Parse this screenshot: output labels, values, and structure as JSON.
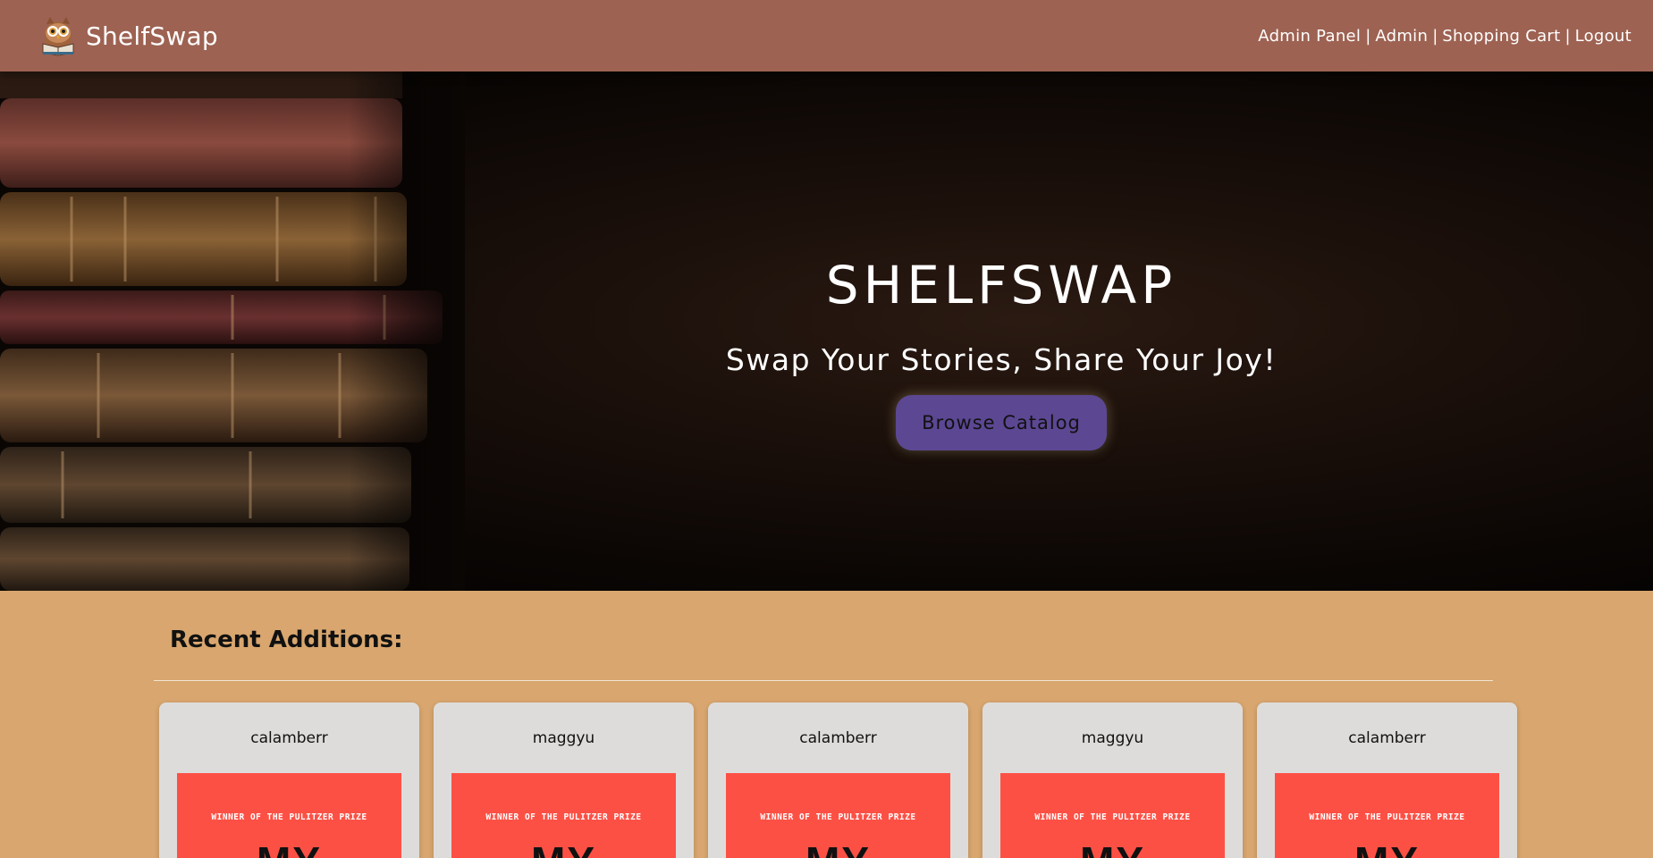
{
  "header": {
    "brand": "ShelfSwap",
    "nav": [
      {
        "label": "Admin Panel"
      },
      {
        "label": "Admin"
      },
      {
        "label": "Shopping Cart"
      },
      {
        "label": "Logout"
      }
    ],
    "separator": "|",
    "logo_icon": "owl-reading-book-icon"
  },
  "hero": {
    "title": "SHELFSWAP",
    "subtitle": "Swap Your Stories, Share Your Joy!",
    "cta_label": "Browse Catalog",
    "background_image": "stack-of-old-books"
  },
  "recent": {
    "heading": "Recent Additions:",
    "cards": [
      {
        "user": "calamberr",
        "cover_award": "WINNER OF THE PULITZER PRIZE",
        "cover_title_partial": "MY"
      },
      {
        "user": "maggyu",
        "cover_award": "WINNER OF THE PULITZER PRIZE",
        "cover_title_partial": "MY"
      },
      {
        "user": "calamberr",
        "cover_award": "WINNER OF THE PULITZER PRIZE",
        "cover_title_partial": "MY"
      },
      {
        "user": "maggyu",
        "cover_award": "WINNER OF THE PULITZER PRIZE",
        "cover_title_partial": "MY"
      },
      {
        "user": "calamberr",
        "cover_award": "WINNER OF THE PULITZER PRIZE",
        "cover_title_partial": "MY"
      }
    ]
  },
  "colors": {
    "header_bg": "#9d6252",
    "page_bg": "#d8a66e",
    "button_bg": "#5c4793",
    "card_bg": "#dedcdb",
    "cover_bg": "#fd5045"
  }
}
